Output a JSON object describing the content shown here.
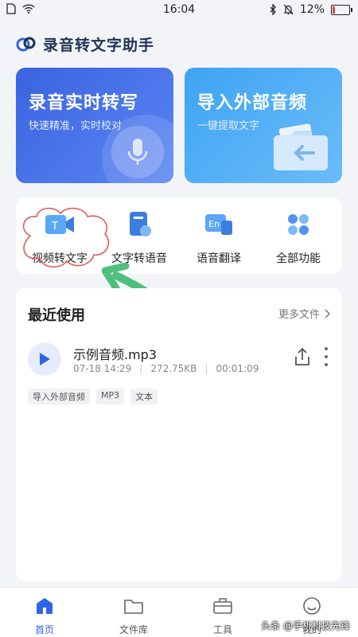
{
  "status": {
    "time": "16:04",
    "battery": "12%"
  },
  "app": {
    "title": "录音转文字助手"
  },
  "cards": {
    "record": {
      "title": "录音实时转写",
      "subtitle": "快速精准，实时校对"
    },
    "import": {
      "title": "导入外部音频",
      "subtitle": "一键提取文字"
    }
  },
  "features": [
    {
      "label": "视频转文字"
    },
    {
      "label": "文字转语音"
    },
    {
      "label": "语音翻译"
    },
    {
      "label": "全部功能"
    }
  ],
  "recent": {
    "title": "最近使用",
    "more": "更多文件",
    "file": {
      "name": "示例音频.mp3",
      "date": "07-18 14:29",
      "size": "272.75KB",
      "duration": "00:01:09"
    },
    "tags": [
      "导入外部音频",
      "MP3",
      "文本"
    ]
  },
  "tabs": [
    {
      "label": "首页",
      "icon": "home-icon",
      "active": true
    },
    {
      "label": "文件库",
      "icon": "folder-icon",
      "active": false
    },
    {
      "label": "工具",
      "icon": "toolbox-icon",
      "active": false
    },
    {
      "label": "我的",
      "icon": "profile-icon",
      "active": false
    }
  ],
  "watermark": "头条 @手机科技先锋",
  "colors": {
    "accent": "#2f64e6",
    "record_card": "#3a63e0",
    "import_card": "#3ea4f4",
    "arrow": "#4fbf7c"
  }
}
